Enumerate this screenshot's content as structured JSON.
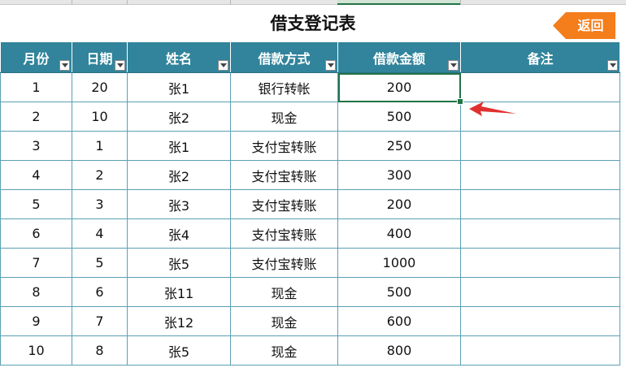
{
  "title": "借支登记表",
  "back_button": {
    "label": "返回"
  },
  "accent_colors": {
    "header": "#31849b",
    "button": "#f47e1c",
    "grid": "#5aa0b4",
    "selection": "#217346",
    "arrow": "#e03030"
  },
  "columns": [
    "月份",
    "日期",
    "姓名",
    "借款方式",
    "借款金额",
    "备注"
  ],
  "rows": [
    [
      "1",
      "20",
      "张1",
      "银行转帐",
      "200",
      ""
    ],
    [
      "2",
      "10",
      "张2",
      "现金",
      "500",
      ""
    ],
    [
      "3",
      "1",
      "张1",
      "支付宝转账",
      "250",
      ""
    ],
    [
      "4",
      "2",
      "张2",
      "支付宝转账",
      "300",
      ""
    ],
    [
      "5",
      "3",
      "张3",
      "支付宝转账",
      "200",
      ""
    ],
    [
      "6",
      "4",
      "张4",
      "支付宝转账",
      "400",
      ""
    ],
    [
      "7",
      "5",
      "张5",
      "支付宝转账",
      "1000",
      ""
    ],
    [
      "8",
      "6",
      "张11",
      "现金",
      "500",
      ""
    ],
    [
      "9",
      "7",
      "张12",
      "现金",
      "600",
      ""
    ],
    [
      "10",
      "8",
      "张5",
      "现金",
      "800",
      ""
    ]
  ],
  "active_cell": {
    "row": 0,
    "col": 4
  },
  "icons": {
    "filter": "dropdown-arrow-icon",
    "pointer": "red-arrow-icon"
  }
}
